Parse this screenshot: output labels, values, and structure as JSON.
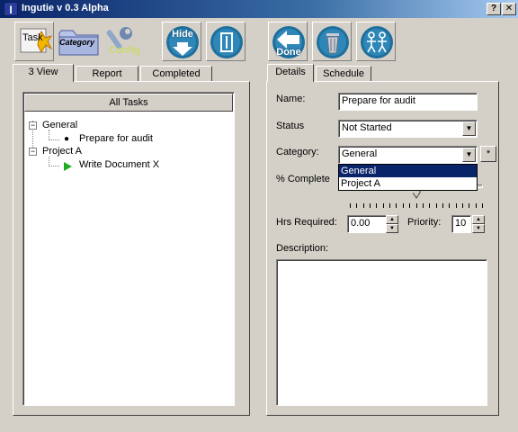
{
  "window": {
    "title": "Ingutie v 0.3 Alpha",
    "help_label": "?",
    "close_label": "✕"
  },
  "toolbar": {
    "task_label": "Task",
    "category_label": "Category",
    "config_label": "Config",
    "hide_label": "Hide",
    "done_label": "Done"
  },
  "left_tabs": [
    "3 View",
    "Report",
    "Completed"
  ],
  "tree": {
    "header": "All Tasks",
    "groups": [
      {
        "label": "General",
        "items": [
          {
            "label": "Prepare for audit",
            "marker": "bullet-icon"
          }
        ]
      },
      {
        "label": "Project A",
        "items": [
          {
            "label": "Write Document X",
            "marker": "play-arrow-icon"
          }
        ]
      }
    ]
  },
  "right_tabs": [
    "Details",
    "Schedule"
  ],
  "details": {
    "name_label": "Name:",
    "name_value": "Prepare for audit",
    "status_label": "Status",
    "status_value": "Not Started",
    "category_label": "Category:",
    "category_value": "General",
    "category_add_label": "*",
    "category_options": [
      "General",
      "Project A"
    ],
    "percent_label": "% Complete",
    "percent_complete": 0.5,
    "hrs_label": "Hrs Required:",
    "hrs_value": "0.00",
    "priority_label": "Priority:",
    "priority_value": "10",
    "description_label": "Description:",
    "description_value": ""
  },
  "colors": {
    "title_start": "#0a246a",
    "title_end": "#a6caf0",
    "selection": "#0a246a",
    "button_round": "#1f6f9c",
    "play_green": "#22aa22"
  }
}
